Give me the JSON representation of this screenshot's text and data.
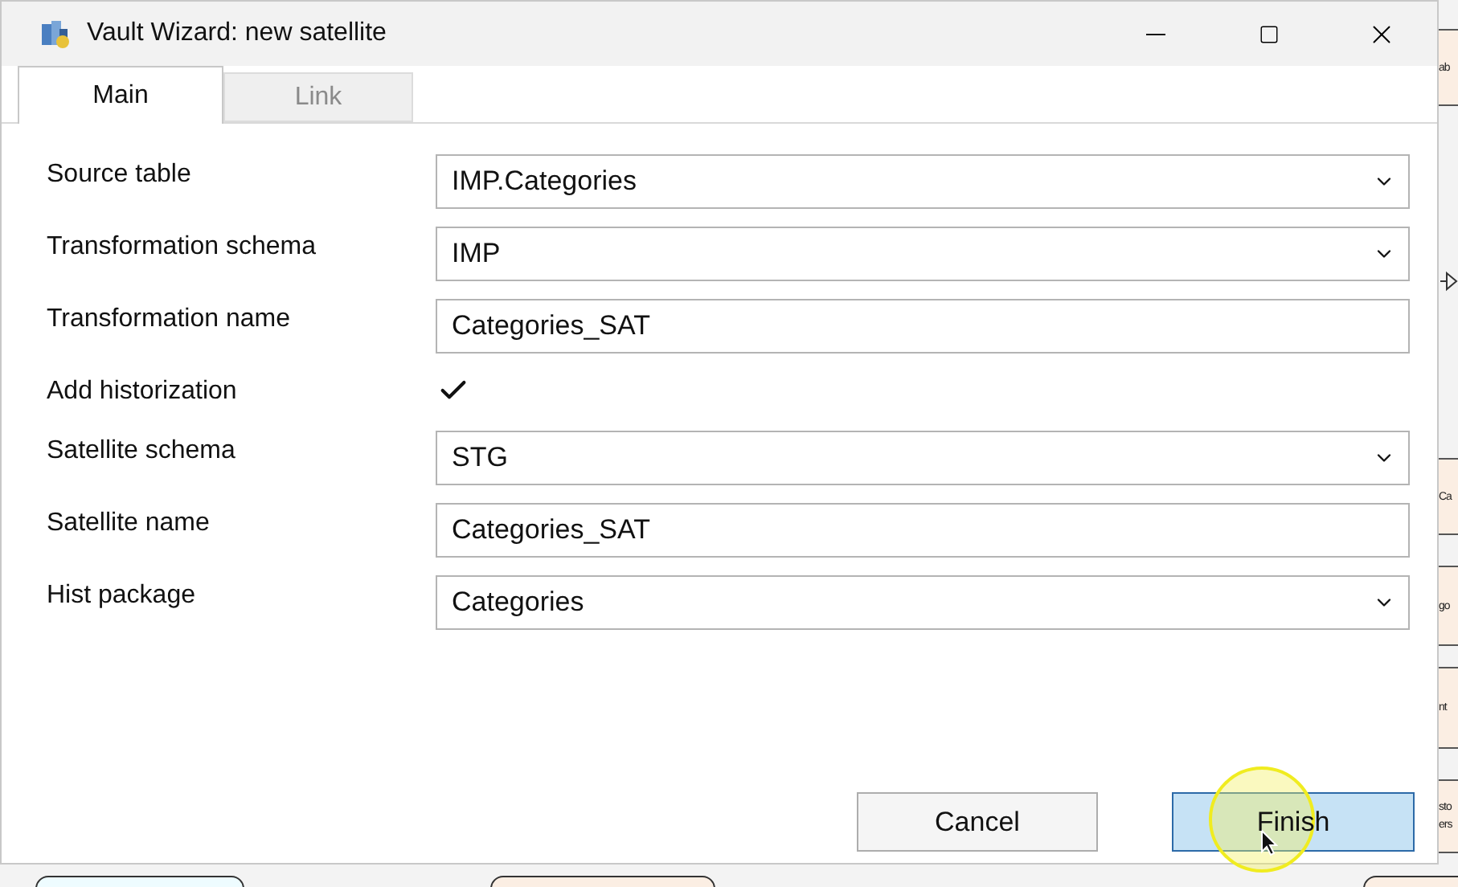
{
  "window": {
    "title": "Vault Wizard: new satellite"
  },
  "tabs": [
    {
      "label": "Main",
      "selected": true
    },
    {
      "label": "Link",
      "selected": false
    }
  ],
  "fields": [
    {
      "label": "Source table",
      "kind": "dropdown",
      "value": "IMP.Categories"
    },
    {
      "label": "Transformation schema",
      "kind": "dropdown",
      "value": "IMP"
    },
    {
      "label": "Transformation name",
      "kind": "text",
      "value": "Categories_SAT"
    },
    {
      "label": "Add historization",
      "kind": "checkbox",
      "checked": true
    },
    {
      "label": "Satellite schema",
      "kind": "dropdown",
      "value": "STG"
    },
    {
      "label": "Satellite name",
      "kind": "text",
      "value": "Categories_SAT"
    },
    {
      "label": "Hist package",
      "kind": "dropdown",
      "value": "Categories"
    }
  ],
  "buttons": [
    {
      "label": "Cancel",
      "kind": "secondary"
    },
    {
      "label": "Finish",
      "kind": "primary"
    }
  ],
  "background_nodes": [
    {
      "lines": [
        "ab"
      ]
    },
    {
      "lines": [
        "Ca"
      ]
    },
    {
      "lines": [
        "go"
      ]
    },
    {
      "lines": [
        "nt"
      ]
    },
    {
      "lines": [
        "sto",
        "ers"
      ]
    }
  ]
}
